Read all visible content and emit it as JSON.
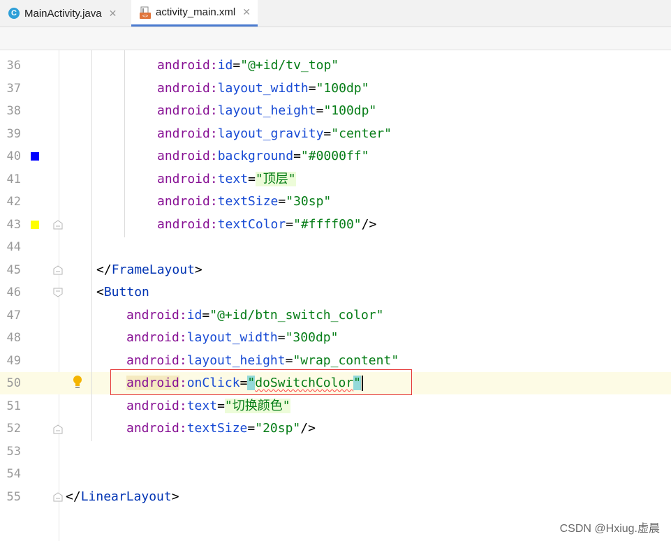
{
  "tabs": [
    {
      "label": "MainActivity.java",
      "icon": "java-class-icon",
      "active": false
    },
    {
      "label": "activity_main.xml",
      "icon": "xml-layout-icon",
      "active": true
    }
  ],
  "gutter": {
    "line_numbers": [
      "36",
      "37",
      "38",
      "39",
      "40",
      "41",
      "42",
      "43",
      "44",
      "45",
      "46",
      "47",
      "48",
      "49",
      "50",
      "51",
      "52",
      "53",
      "54",
      "55"
    ],
    "swatches": [
      {
        "line": "40",
        "color": "#0000ff"
      },
      {
        "line": "43",
        "color": "#ffff00"
      }
    ]
  },
  "code": {
    "l36": {
      "ns": "android",
      "sep": ":",
      "attr": "id",
      "eq": "=",
      "val": "\"@+id/tv_top\""
    },
    "l37": {
      "ns": "android",
      "sep": ":",
      "attr": "layout_width",
      "eq": "=",
      "val": "\"100dp\""
    },
    "l38": {
      "ns": "android",
      "sep": ":",
      "attr": "layout_height",
      "eq": "=",
      "val": "\"100dp\""
    },
    "l39": {
      "ns": "android",
      "sep": ":",
      "attr": "layout_gravity",
      "eq": "=",
      "val": "\"center\""
    },
    "l40": {
      "ns": "android",
      "sep": ":",
      "attr": "background",
      "eq": "=",
      "val": "\"#0000ff\""
    },
    "l41": {
      "ns": "android",
      "sep": ":",
      "attr": "text",
      "eq": "=",
      "val": "\"顶层\""
    },
    "l42": {
      "ns": "android",
      "sep": ":",
      "attr": "textSize",
      "eq": "=",
      "val": "\"30sp\""
    },
    "l43": {
      "ns": "android",
      "sep": ":",
      "attr": "textColor",
      "eq": "=",
      "val": "\"#ffff00\"",
      "end": "/>"
    },
    "l45": {
      "open": "</",
      "tag": "FrameLayout",
      "close": ">"
    },
    "l46": {
      "open": "<",
      "tag": "Button"
    },
    "l47": {
      "ns": "android",
      "sep": ":",
      "attr": "id",
      "eq": "=",
      "val": "\"@+id/btn_switch_color\""
    },
    "l48": {
      "ns": "android",
      "sep": ":",
      "attr": "layout_width",
      "eq": "=",
      "val": "\"300dp\""
    },
    "l49": {
      "ns": "android",
      "sep": ":",
      "attr": "layout_height",
      "eq": "=",
      "val": "\"wrap_content\""
    },
    "l50": {
      "ns": "android",
      "sep": ":",
      "attr": "onClick",
      "eq": "=",
      "q1": "\"",
      "val": "doSwitchColor",
      "q2": "\""
    },
    "l51": {
      "ns": "android",
      "sep": ":",
      "attr": "text",
      "eq": "=",
      "val": "\"切换颜色\""
    },
    "l52": {
      "ns": "android",
      "sep": ":",
      "attr": "textSize",
      "eq": "=",
      "val": "\"20sp\"",
      "end": "/>"
    },
    "l55": {
      "open": "</",
      "tag": "LinearLayout",
      "close": ">"
    }
  },
  "watermark": "CSDN @Hxiug.虚晨"
}
